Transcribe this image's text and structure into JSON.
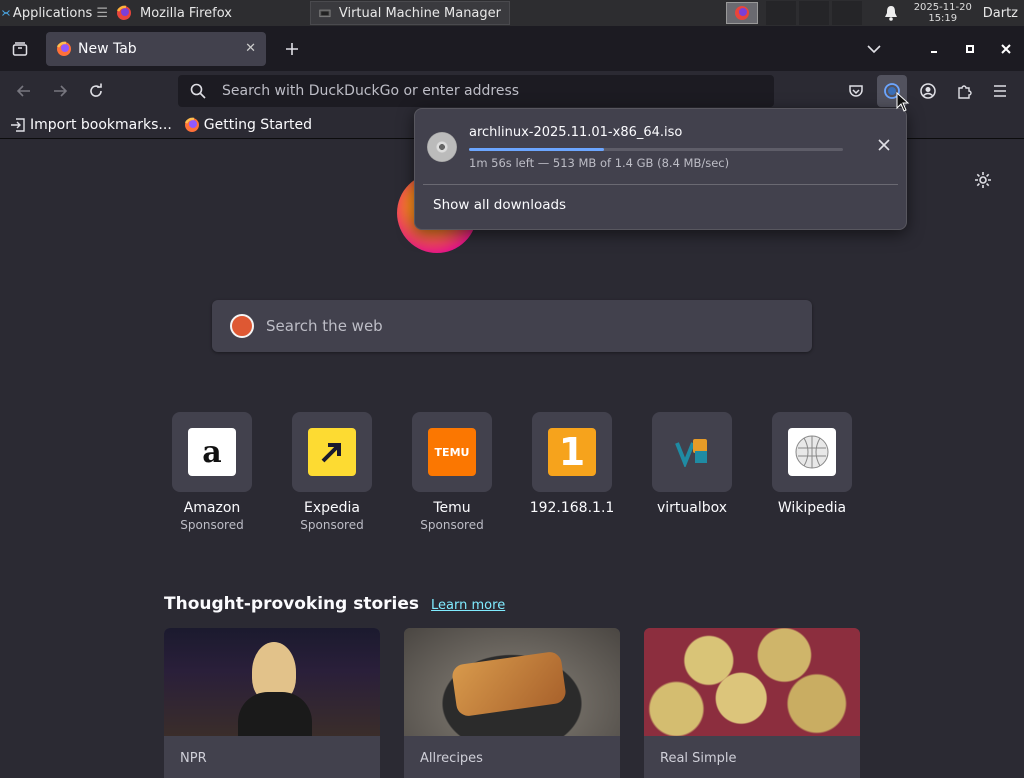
{
  "taskbar": {
    "applications_label": "Applications",
    "windows": [
      {
        "label": "Mozilla Firefox"
      },
      {
        "label": "Virtual Machine Manager"
      }
    ],
    "clock_date": "2025-11-20",
    "clock_time": "15:19",
    "user": "Dartz"
  },
  "tabs": [
    {
      "label": "New Tab"
    }
  ],
  "urlbar": {
    "placeholder": "Search with DuckDuckGo or enter address"
  },
  "bookmarks": [
    {
      "label": "Import bookmarks..."
    },
    {
      "label": "Getting Started"
    }
  ],
  "downloads": {
    "filename": "archlinux-2025.11.01-x86_64.iso",
    "status": "1m 56s left — 513 MB of 1.4 GB (8.4 MB/sec)",
    "progress_fraction": 0.36,
    "show_all_label": "Show all downloads"
  },
  "websearch": {
    "placeholder": "Search the web"
  },
  "topsites": [
    {
      "name": "Amazon",
      "sponsored": "Sponsored"
    },
    {
      "name": "Expedia",
      "sponsored": "Sponsored"
    },
    {
      "name": "Temu",
      "sponsored": "Sponsored"
    },
    {
      "name": "192.168.1.1",
      "sponsored": ""
    },
    {
      "name": "virtualbox",
      "sponsored": ""
    },
    {
      "name": "Wikipedia",
      "sponsored": ""
    }
  ],
  "temu_logo_text": "TEMU",
  "stories": {
    "heading": "Thought-provoking stories",
    "learn_more": "Learn more",
    "cards": [
      {
        "source": "NPR"
      },
      {
        "source": "Allrecipes"
      },
      {
        "source": "Real Simple"
      }
    ]
  },
  "colors": {
    "accent": "#6ca6ff",
    "link": "#80ebff",
    "background": "#2b2a33"
  }
}
